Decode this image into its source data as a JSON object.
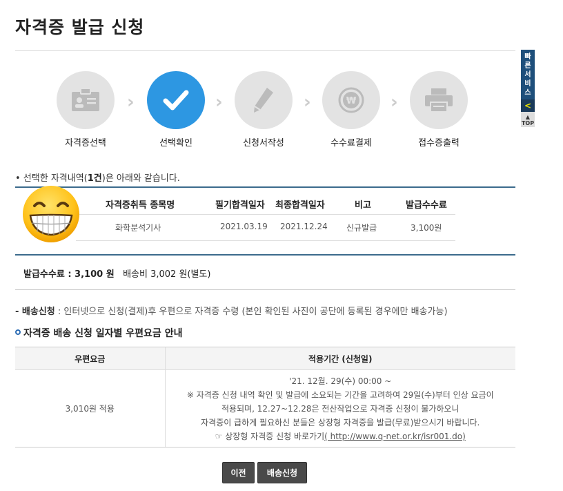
{
  "page": {
    "title": "자격증 발급 신청"
  },
  "quick": {
    "label": "빠른서비스",
    "arrow": "<",
    "top": "TOP"
  },
  "steps": [
    {
      "label": "자격증선택",
      "icon": "id-card-icon"
    },
    {
      "label": "선택확인",
      "icon": "checkmark-icon"
    },
    {
      "label": "신청서작성",
      "icon": "pencil-icon"
    },
    {
      "label": "수수료결제",
      "icon": "won-coin-icon"
    },
    {
      "label": "접수증출력",
      "icon": "printer-icon"
    }
  ],
  "selection": {
    "prefix": "• 선택한 자격내역(",
    "count": "1건",
    "suffix": ")은 아래와 같습니다."
  },
  "cert_table": {
    "headers": [
      "자격증취득 종목명",
      "필기합격일자",
      "최종합격일자",
      "비고",
      "발급수수료"
    ],
    "rows": [
      [
        "화학분석기사",
        "2021.03.19",
        "2021.12.24",
        "신규발급",
        "3,100원"
      ]
    ]
  },
  "fee": {
    "label": "발급수수료 : 3,100 원",
    "shipping": "배송비 3,002 원(별도)"
  },
  "delivery": {
    "label": "- 배송신청",
    "text": " : 인터넷으로 신청(결제)후 우편으로 자격증 수령 (본인 확인된 사진이 공단에 등록된 경우에만 배송가능)"
  },
  "rate_section": {
    "title": "자격증 배송 신청 일자별 우편요금 안내",
    "headers": [
      "우편요금",
      "적용기간 (신청일)"
    ],
    "fee_value": "3,010원 적용",
    "lines": [
      "'21. 12월. 29(수) 00:00 ~",
      "※ 자격증 신청 내역 확인 및 발급에 소요되는 기간을 고려하여 29일(수)부터 인상 요금이",
      "적용되며, 12.27~12.28은 전산작업으로 자격증 신청이 불가하오니",
      "자격증이 급하게 필요하신 분들은 상장형 자격증을 발급(무료)받으시기 바랍니다."
    ],
    "link_prefix": "☞ 상장형 자격증 신청 바로가기",
    "link_text": "( http://www.q-net.or.kr/isr001.do)"
  },
  "buttons": {
    "prev": "이전",
    "delivery": "배송신청"
  },
  "colors": {
    "active_step": "#2d97e2",
    "inactive_step": "#e3e3e3",
    "rule": "#3b6a8c",
    "button": "#4a4a4a"
  }
}
